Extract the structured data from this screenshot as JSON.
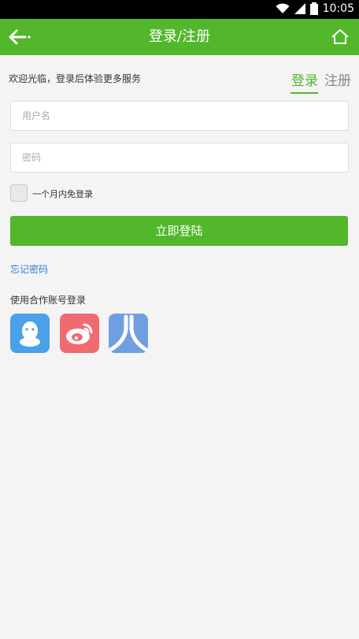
{
  "status_bar": {
    "time": "10:05"
  },
  "app_bar": {
    "title": "登录/注册"
  },
  "welcome_text": "欢迎光临，登录后体验更多服务",
  "tabs": {
    "login": "登录",
    "register": "注册"
  },
  "form": {
    "username_placeholder": "用户名",
    "password_placeholder": "密码",
    "remember_label": "一个月内免登录",
    "login_button": "立即登陆",
    "forgot_password": "忘记密码"
  },
  "partner_login_label": "使用合作账号登录",
  "social": [
    "qq-icon",
    "weibo-icon",
    "renren-icon"
  ],
  "colors": {
    "primary": "#52b72a",
    "link": "#2a7fd3",
    "qq": "#4aa0e9",
    "weibo": "#ef6b6f",
    "renren": "#6f9fe0"
  }
}
